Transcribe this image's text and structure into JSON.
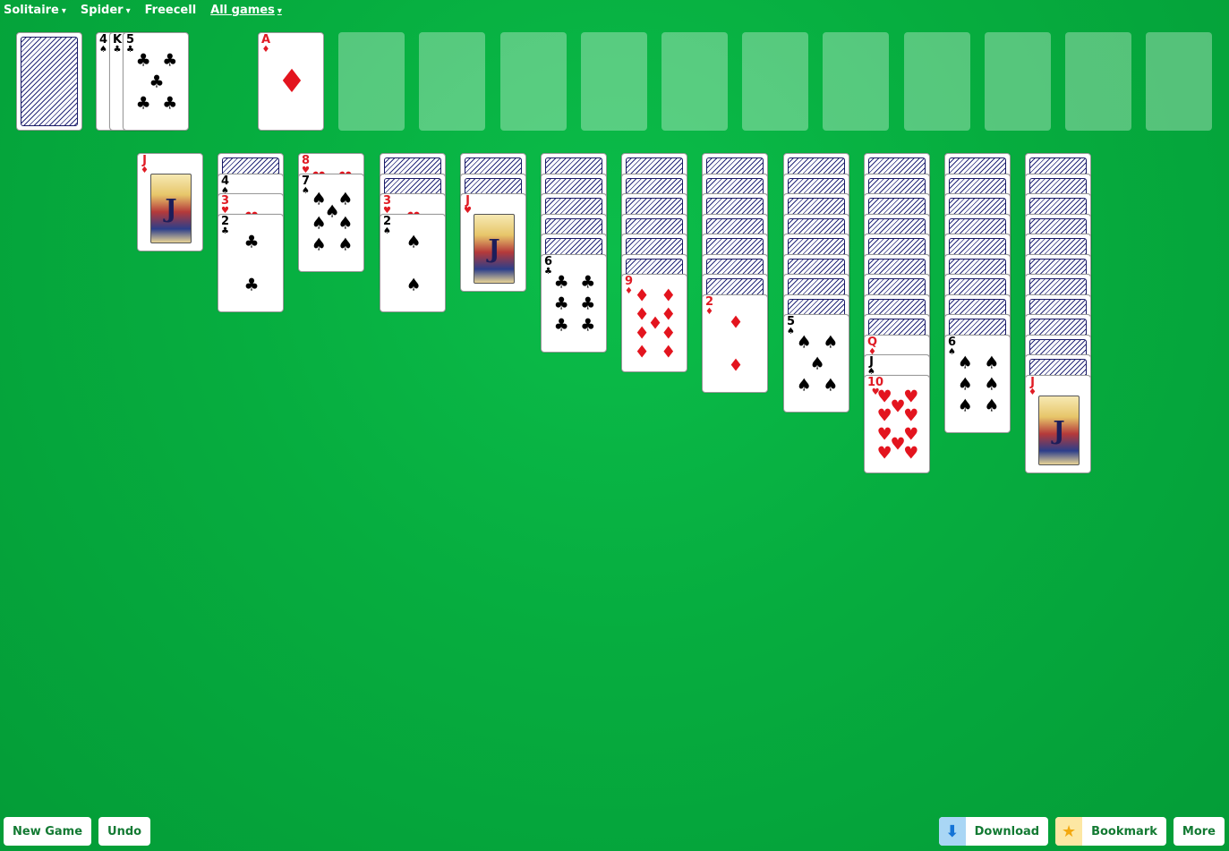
{
  "nav": [
    {
      "label": "Solitaire",
      "arrow": "▾"
    },
    {
      "label": "Spider",
      "arrow": "▾"
    },
    {
      "label": "Freecell",
      "arrow": ""
    },
    {
      "label": "All games",
      "arrow": "▾"
    }
  ],
  "stock": {
    "count_visible": 1
  },
  "waste": [
    {
      "rank": "4",
      "suit": "♠",
      "color": "black"
    },
    {
      "rank": "K",
      "suit": "♣",
      "color": "black"
    },
    {
      "rank": "5",
      "suit": "♣",
      "color": "black"
    }
  ],
  "foundations": [
    {
      "rank": "A",
      "suit": "♦",
      "color": "red"
    },
    null,
    null,
    null,
    null,
    null,
    null,
    null,
    null,
    null,
    null,
    null
  ],
  "tableau": [
    {
      "down": 0,
      "up": [
        {
          "rank": "J",
          "suit": "♦",
          "color": "red"
        }
      ]
    },
    {
      "down": 1,
      "up": [
        {
          "rank": "4",
          "suit": "♠",
          "color": "black"
        },
        {
          "rank": "3",
          "suit": "♥",
          "color": "red"
        },
        {
          "rank": "2",
          "suit": "♣",
          "color": "black"
        }
      ]
    },
    {
      "down": 0,
      "up": [
        {
          "rank": "8",
          "suit": "♥",
          "color": "red"
        },
        {
          "rank": "7",
          "suit": "♠",
          "color": "black"
        }
      ]
    },
    {
      "down": 2,
      "up": [
        {
          "rank": "3",
          "suit": "♥",
          "color": "red"
        },
        {
          "rank": "2",
          "suit": "♠",
          "color": "black"
        }
      ]
    },
    {
      "down": 2,
      "up": [
        {
          "rank": "J",
          "suit": "♥",
          "color": "red"
        }
      ]
    },
    {
      "down": 5,
      "up": [
        {
          "rank": "6",
          "suit": "♣",
          "color": "black"
        }
      ]
    },
    {
      "down": 6,
      "up": [
        {
          "rank": "9",
          "suit": "♦",
          "color": "red"
        }
      ]
    },
    {
      "down": 7,
      "up": [
        {
          "rank": "2",
          "suit": "♦",
          "color": "red"
        }
      ]
    },
    {
      "down": 8,
      "up": [
        {
          "rank": "5",
          "suit": "♠",
          "color": "black"
        }
      ]
    },
    {
      "down": 9,
      "up": [
        {
          "rank": "Q",
          "suit": "♦",
          "color": "red"
        },
        {
          "rank": "J",
          "suit": "♠",
          "color": "black"
        },
        {
          "rank": "10",
          "suit": "♥",
          "color": "red"
        }
      ]
    },
    {
      "down": 9,
      "up": [
        {
          "rank": "6",
          "suit": "♠",
          "color": "black"
        }
      ]
    },
    {
      "down": 11,
      "up": [
        {
          "rank": "J",
          "suit": "♦",
          "color": "red"
        }
      ]
    }
  ],
  "buttons": {
    "new_game": "New Game",
    "undo": "Undo",
    "download": "Download",
    "bookmark": "Bookmark",
    "more": "More"
  },
  "icons": {
    "download": "arrow-down-icon",
    "bookmark": "star-icon"
  }
}
